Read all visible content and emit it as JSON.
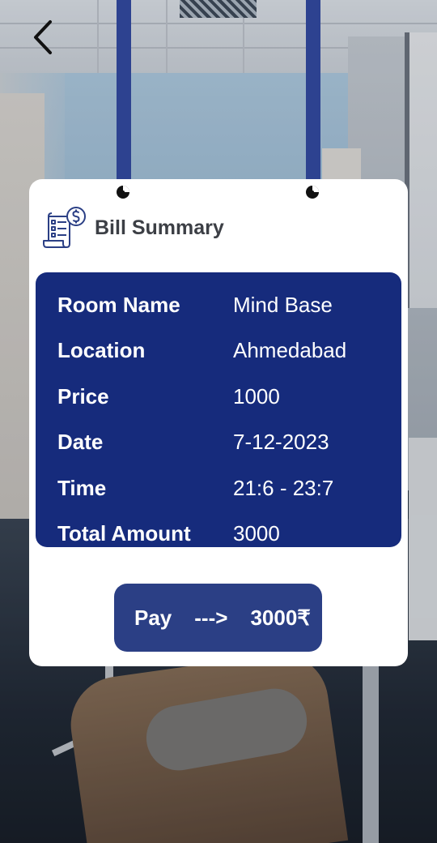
{
  "screen": {
    "title": "Bill Summary"
  },
  "colors": {
    "card_background": "#ffffff",
    "details_panel": "#162b7c",
    "pay_button": "#2b3f85",
    "strap": "#2d4290",
    "title_text": "#3c3f45",
    "detail_text": "#ffffff"
  },
  "icons": {
    "back": "chevron-left-icon",
    "bill": "receipt-dollar-icon",
    "pin": "pin-icon"
  },
  "details": [
    {
      "label": "Room Name",
      "value": "Mind Base"
    },
    {
      "label": "Location",
      "value": "Ahmedabad"
    },
    {
      "label": "Price",
      "value": "1000"
    },
    {
      "label": "Date",
      "value": "7-12-2023"
    },
    {
      "label": "Time",
      "value": "21:6 - 23:7"
    },
    {
      "label": "Total Amount",
      "value": "3000"
    }
  ],
  "pay_button": {
    "label": "Pay",
    "arrow": "--->",
    "amount": "3000₹"
  }
}
